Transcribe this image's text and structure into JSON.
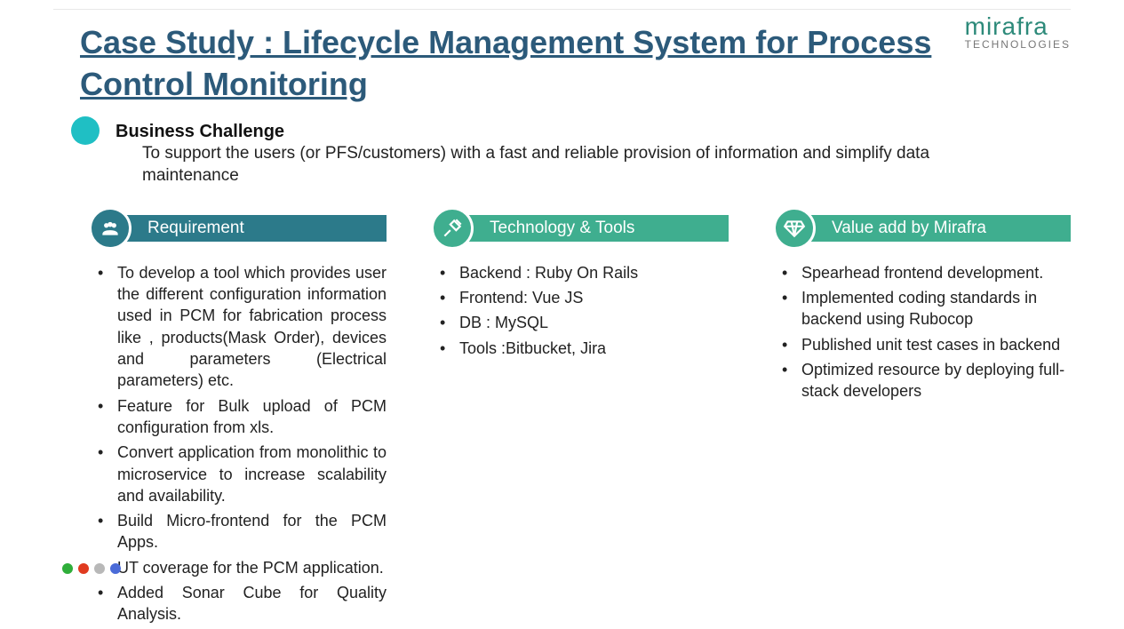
{
  "logo": {
    "name": "mirafra",
    "sub": "TECHNOLOGIES"
  },
  "title": "Case Study : Lifecycle Management System for Process Control Monitoring",
  "challenge": {
    "label": "Business Challenge",
    "desc": "To support the users (or PFS/customers) with a fast and reliable provision of information and simplify data maintenance"
  },
  "columns": {
    "requirement": {
      "heading": "Requirement",
      "items": [
        "To develop a tool which provides user the different configuration information used in PCM for fabrication process like , products(Mask Order), devices and parameters (Electrical parameters) etc.",
        "Feature for Bulk upload of PCM configuration from xls.",
        "Convert application from monolithic to microservice to increase scalability and availability.",
        "Build Micro-frontend for the PCM Apps.",
        "UT coverage for the PCM application.",
        "Added Sonar Cube for Quality Analysis."
      ]
    },
    "technology": {
      "heading": "Technology & Tools",
      "items": [
        "Backend : Ruby On Rails",
        "Frontend: Vue JS",
        "DB :  MySQL",
        "Tools :Bitbucket, Jira"
      ]
    },
    "value": {
      "heading": "Value add by Mirafra",
      "items": [
        "Spearhead frontend development.",
        "Implemented coding standards in backend using Rubocop",
        "Published unit test cases in backend",
        "Optimized resource by deploying full-stack developers"
      ]
    }
  },
  "dots": [
    "#2fae3a",
    "#e03a1f",
    "#b8b8b8",
    "#4a6bd8"
  ]
}
